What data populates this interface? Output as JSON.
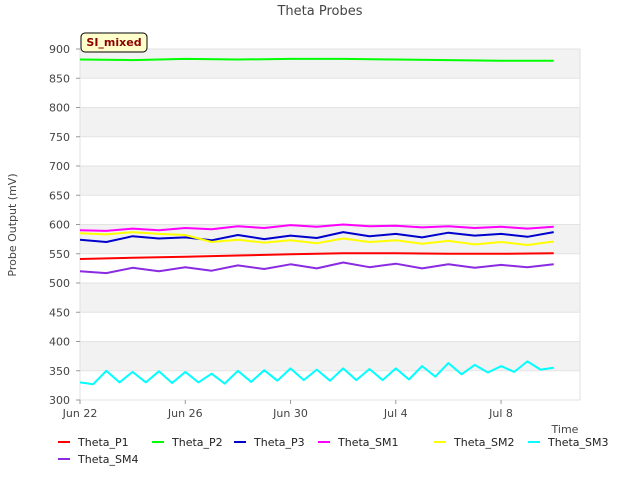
{
  "chart_data": {
    "type": "line",
    "title": "Theta Probes",
    "xlabel": "Time",
    "ylabel": "Probe Output (mV)",
    "ylim": [
      300,
      900
    ],
    "yticks": [
      300,
      350,
      400,
      450,
      500,
      550,
      600,
      650,
      700,
      750,
      800,
      850,
      900
    ],
    "xlim": [
      "2020-06-22",
      "2020-07-11"
    ],
    "xticks": [
      {
        "date": "2020-06-22",
        "label": "Jun 22"
      },
      {
        "date": "2020-06-26",
        "label": "Jun 26"
      },
      {
        "date": "2020-06-30",
        "label": "Jun 30"
      },
      {
        "date": "2020-07-04",
        "label": "Jul 4"
      },
      {
        "date": "2020-07-08",
        "label": "Jul 8"
      }
    ],
    "grid": "horizontal alternating bands",
    "badge": "SI_mixed",
    "legend_position": "bottom",
    "series": [
      {
        "name": "Theta_P1",
        "color": "#ff0000",
        "x": [
          "2020-06-22",
          "2020-06-24",
          "2020-06-26",
          "2020-06-28",
          "2020-06-30",
          "2020-07-02",
          "2020-07-04",
          "2020-07-06",
          "2020-07-08",
          "2020-07-10"
        ],
        "values": [
          541,
          543,
          545,
          547,
          549,
          551,
          551,
          550,
          550,
          551
        ]
      },
      {
        "name": "Theta_P2",
        "color": "#00ff00",
        "x": [
          "2020-06-22",
          "2020-06-24",
          "2020-06-26",
          "2020-06-28",
          "2020-06-30",
          "2020-07-02",
          "2020-07-04",
          "2020-07-06",
          "2020-07-08",
          "2020-07-10"
        ],
        "values": [
          882,
          881,
          883,
          882,
          883,
          883,
          882,
          881,
          880,
          880
        ]
      },
      {
        "name": "Theta_P3",
        "color": "#0000cc",
        "x": [
          "2020-06-22",
          "2020-06-23",
          "2020-06-24",
          "2020-06-25",
          "2020-06-26",
          "2020-06-27",
          "2020-06-28",
          "2020-06-29",
          "2020-06-30",
          "2020-07-01",
          "2020-07-02",
          "2020-07-03",
          "2020-07-04",
          "2020-07-05",
          "2020-07-06",
          "2020-07-07",
          "2020-07-08",
          "2020-07-09",
          "2020-07-10"
        ],
        "values": [
          574,
          570,
          580,
          576,
          578,
          573,
          582,
          575,
          581,
          577,
          587,
          580,
          584,
          578,
          586,
          581,
          584,
          579,
          587
        ]
      },
      {
        "name": "Theta_SM1",
        "color": "#ff00ff",
        "x": [
          "2020-06-22",
          "2020-06-23",
          "2020-06-24",
          "2020-06-25",
          "2020-06-26",
          "2020-06-27",
          "2020-06-28",
          "2020-06-29",
          "2020-06-30",
          "2020-07-01",
          "2020-07-02",
          "2020-07-03",
          "2020-07-04",
          "2020-07-05",
          "2020-07-06",
          "2020-07-07",
          "2020-07-08",
          "2020-07-09",
          "2020-07-10"
        ],
        "values": [
          590,
          589,
          593,
          590,
          594,
          592,
          597,
          594,
          599,
          596,
          600,
          597,
          598,
          595,
          597,
          594,
          596,
          593,
          596
        ]
      },
      {
        "name": "Theta_SM2",
        "color": "#ffff00",
        "x": [
          "2020-06-22",
          "2020-06-23",
          "2020-06-24",
          "2020-06-25",
          "2020-06-26",
          "2020-06-27",
          "2020-06-28",
          "2020-06-29",
          "2020-06-30",
          "2020-07-01",
          "2020-07-02",
          "2020-07-03",
          "2020-07-04",
          "2020-07-05",
          "2020-07-06",
          "2020-07-07",
          "2020-07-08",
          "2020-07-09",
          "2020-07-10"
        ],
        "values": [
          585,
          583,
          587,
          584,
          582,
          570,
          574,
          569,
          573,
          568,
          576,
          570,
          573,
          567,
          572,
          566,
          570,
          565,
          571
        ]
      },
      {
        "name": "Theta_SM3",
        "color": "#00ffff",
        "x": [
          "2020-06-22",
          "2020-06-22.5",
          "2020-06-23",
          "2020-06-23.5",
          "2020-06-24",
          "2020-06-24.5",
          "2020-06-25",
          "2020-06-25.5",
          "2020-06-26",
          "2020-06-26.5",
          "2020-06-27",
          "2020-06-27.5",
          "2020-06-28",
          "2020-06-28.5",
          "2020-06-29",
          "2020-06-29.5",
          "2020-06-30",
          "2020-06-30.5",
          "2020-07-01",
          "2020-07-01.5",
          "2020-07-02",
          "2020-07-02.5",
          "2020-07-03",
          "2020-07-03.5",
          "2020-07-04",
          "2020-07-04.5",
          "2020-07-05",
          "2020-07-05.5",
          "2020-07-06",
          "2020-07-06.5",
          "2020-07-07",
          "2020-07-07.5",
          "2020-07-08",
          "2020-07-08.5",
          "2020-07-09",
          "2020-07-09.5",
          "2020-07-10"
        ],
        "values": [
          330,
          327,
          350,
          330,
          348,
          330,
          349,
          329,
          348,
          330,
          345,
          328,
          350,
          331,
          351,
          333,
          354,
          334,
          352,
          333,
          354,
          334,
          353,
          334,
          354,
          335,
          358,
          340,
          363,
          344,
          360,
          347,
          358,
          348,
          366,
          352,
          355
        ]
      },
      {
        "name": "Theta_SM4",
        "color": "#8a2be2",
        "x": [
          "2020-06-22",
          "2020-06-23",
          "2020-06-24",
          "2020-06-25",
          "2020-06-26",
          "2020-06-27",
          "2020-06-28",
          "2020-06-29",
          "2020-06-30",
          "2020-07-01",
          "2020-07-02",
          "2020-07-03",
          "2020-07-04",
          "2020-07-05",
          "2020-07-06",
          "2020-07-07",
          "2020-07-08",
          "2020-07-09",
          "2020-07-10"
        ],
        "values": [
          520,
          517,
          526,
          520,
          527,
          521,
          530,
          524,
          532,
          525,
          535,
          527,
          533,
          525,
          532,
          526,
          531,
          527,
          532
        ]
      }
    ]
  }
}
